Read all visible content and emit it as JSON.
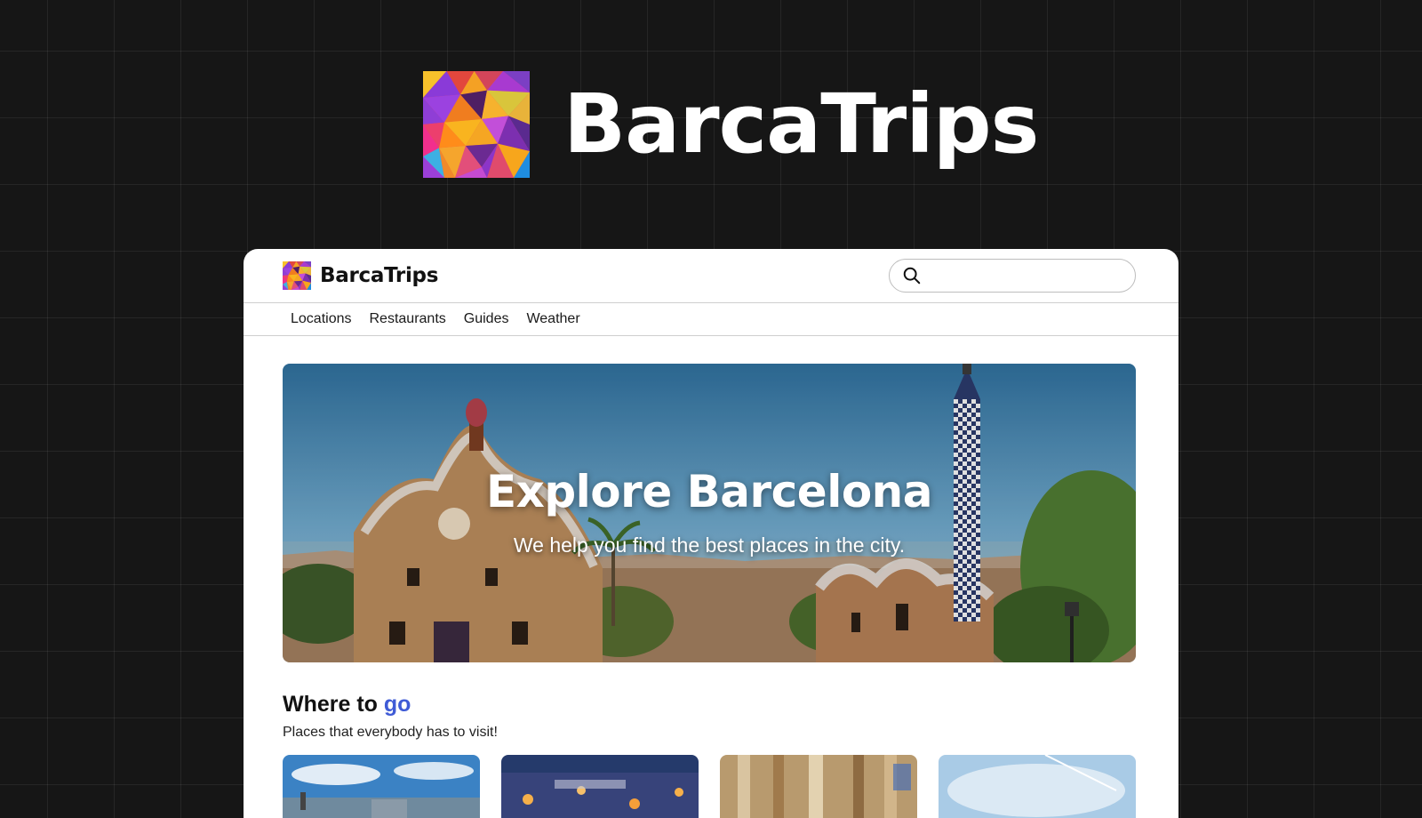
{
  "hero": {
    "brand_name": "BarcaTrips"
  },
  "header": {
    "brand_name": "BarcaTrips",
    "search": {
      "placeholder": "",
      "value": ""
    }
  },
  "nav": {
    "items": [
      {
        "label": "Locations"
      },
      {
        "label": "Restaurants"
      },
      {
        "label": "Guides"
      },
      {
        "label": "Weather"
      }
    ]
  },
  "banner": {
    "title": "Explore Barcelona",
    "subtitle": "We help you find the best places in the city."
  },
  "section": {
    "title_prefix": "Where to",
    "title_accent": "go",
    "subtitle": "Places that everybody has to visit!"
  },
  "colors": {
    "page_background": "#161616",
    "accent": "#3f5bd6",
    "window_background": "#ffffff"
  },
  "icons": {
    "logo": "mosaic-logo-icon",
    "search": "search-icon"
  }
}
